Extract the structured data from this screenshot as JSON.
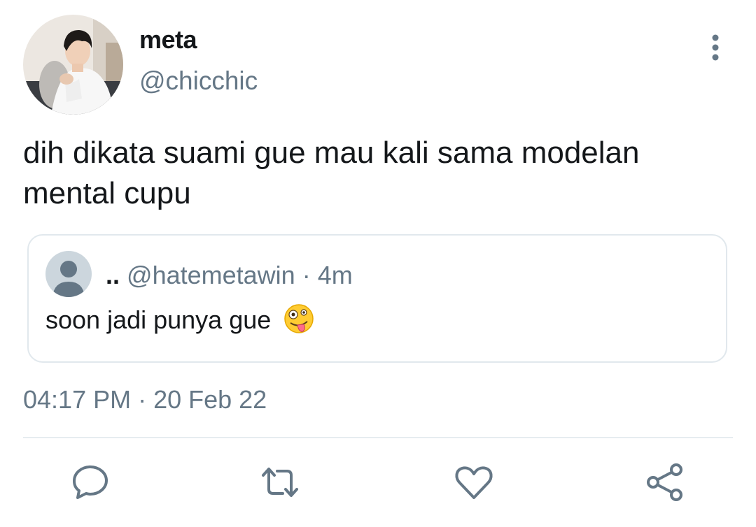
{
  "tweet": {
    "display_name": "meta",
    "handle": "@chicchic",
    "text": "dih dikata suami gue mau kali sama modelan mental cupu",
    "timestamp": "04:17 PM · 20 Feb 22"
  },
  "quote": {
    "name": "..",
    "handle": "@hatemetawin",
    "separator": "·",
    "age": "4m",
    "text": "soon jadi punya gue",
    "emoji": "zany-face-emoji"
  },
  "actions": [
    "reply-icon",
    "retweet-icon",
    "like-icon",
    "share-icon"
  ],
  "colors": {
    "text": "#14171a",
    "secondary": "#657786",
    "border": "#e1e8ed",
    "icon": "#657786"
  }
}
